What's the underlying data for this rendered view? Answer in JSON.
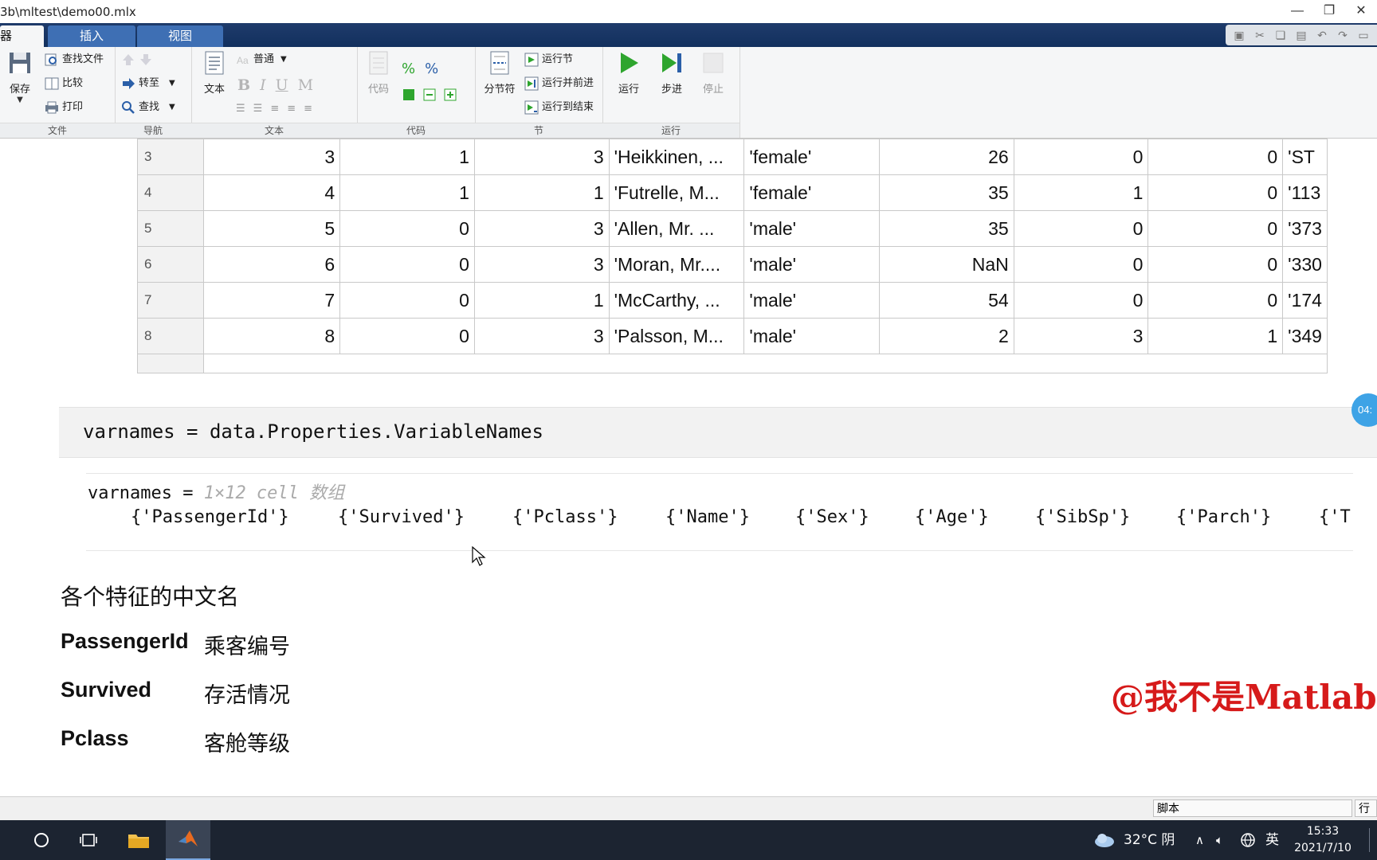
{
  "window": {
    "title": "3b\\mltest\\demo00.mlx",
    "controls": [
      "—",
      "❐",
      "✕"
    ]
  },
  "ribbon_tabs": [
    {
      "label": "器"
    },
    {
      "label": "插入"
    },
    {
      "label": "视图"
    }
  ],
  "quick_access": [
    "save-icon",
    "cut-icon",
    "copy-icon",
    "paste-icon",
    "undo-icon",
    "redo-icon",
    "dock-icon"
  ],
  "ribbon": {
    "file": {
      "label": "文件",
      "save": "保存",
      "find_files": "查找文件",
      "compare": "比较",
      "print": "打印"
    },
    "navigate": {
      "label": "导航",
      "goto": "转至",
      "find": "查找"
    },
    "text": {
      "label": "文本",
      "text_btn": "文本",
      "style": "普通",
      "bold": "B",
      "italic": "I",
      "underline": "U",
      "mono": "M"
    },
    "code": {
      "label": "代码",
      "code_btn": "代码"
    },
    "section": {
      "label": "节",
      "section_break": "分节符",
      "run_section": "运行节",
      "run_advance": "运行并前进",
      "run_to_end": "运行到结束"
    },
    "run": {
      "label": "运行",
      "run": "运行",
      "step": "步进",
      "stop": "停止"
    }
  },
  "table": {
    "rows": [
      {
        "row": "3",
        "cells": [
          "3",
          "1",
          "3",
          "'Heikkinen, ...",
          "'female'",
          "26",
          "0",
          "0",
          "'ST"
        ]
      },
      {
        "row": "4",
        "cells": [
          "4",
          "1",
          "1",
          "'Futrelle, M...",
          "'female'",
          "35",
          "1",
          "0",
          "'113"
        ]
      },
      {
        "row": "5",
        "cells": [
          "5",
          "0",
          "3",
          "'Allen, Mr. ...",
          "'male'",
          "35",
          "0",
          "0",
          "'373"
        ]
      },
      {
        "row": "6",
        "cells": [
          "6",
          "0",
          "3",
          "'Moran, Mr....",
          "'male'",
          "NaN",
          "0",
          "0",
          "'330"
        ]
      },
      {
        "row": "7",
        "cells": [
          "7",
          "0",
          "1",
          "'McCarthy, ...",
          "'male'",
          "54",
          "0",
          "0",
          "'174"
        ]
      },
      {
        "row": "8",
        "cells": [
          "8",
          "0",
          "3",
          "'Palsson, M...",
          "'male'",
          "2",
          "3",
          "1",
          "'349"
        ]
      }
    ]
  },
  "code_cell": {
    "code": "varnames = data.Properties.VariableNames",
    "timer_badge": "04:"
  },
  "output": {
    "var": "varnames = ",
    "desc": "1×12 cell 数组",
    "cells": [
      "{'PassengerId'}",
      "{'Survived'}",
      "{'Pclass'}",
      "{'Name'}",
      "{'Sex'}",
      "{'Age'}",
      "{'SibSp'}",
      "{'Parch'}",
      "{'T"
    ]
  },
  "text_section": {
    "heading": "各个特征的中文名",
    "features": [
      {
        "key": "PassengerId",
        "value": "乘客编号"
      },
      {
        "key": "Survived",
        "value": "存活情况"
      },
      {
        "key": "Pclass",
        "value": "客舱等级"
      }
    ],
    "watermark": "@我不是Matlab"
  },
  "statusbar": {
    "script": "脚本",
    "row": "行"
  },
  "taskbar": {
    "weather": "32°C 阴",
    "ime": "英",
    "time": "15:33",
    "date": "2021/7/10"
  },
  "colors": {
    "ribbon_blue": "#12305e",
    "tab_blue": "#3e6fb4",
    "run_green": "#2ea52e",
    "watermark_red": "#d61a1a"
  }
}
